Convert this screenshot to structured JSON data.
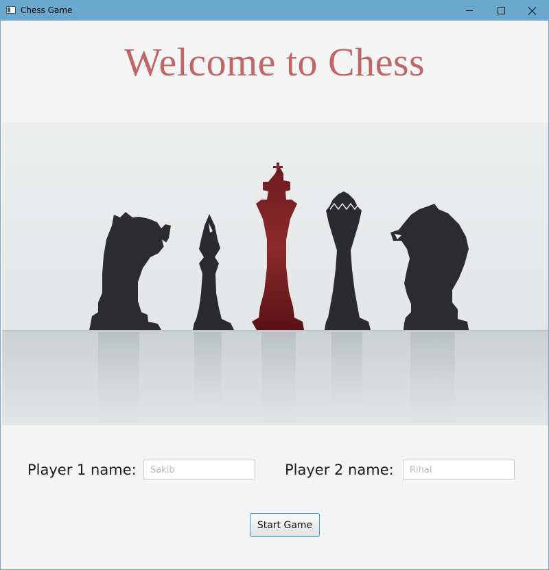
{
  "window": {
    "title": "Chess Game",
    "titlebar_color": "#6aa8ce"
  },
  "main": {
    "heading": "Welcome to Chess",
    "heading_color": "#c06666",
    "hero_image": {
      "pieces": [
        "knight-piece",
        "bishop-piece",
        "king-piece",
        "queen-piece",
        "knight-piece"
      ],
      "accent_piece_color": "#8a1f22",
      "piece_color": "#2a2a2e"
    }
  },
  "form": {
    "player1_label": "Player 1 name:",
    "player1_placeholder": "Sakib",
    "player2_label": "Player 2 name:",
    "player2_placeholder": "Rihal",
    "start_button": "Start Game"
  }
}
